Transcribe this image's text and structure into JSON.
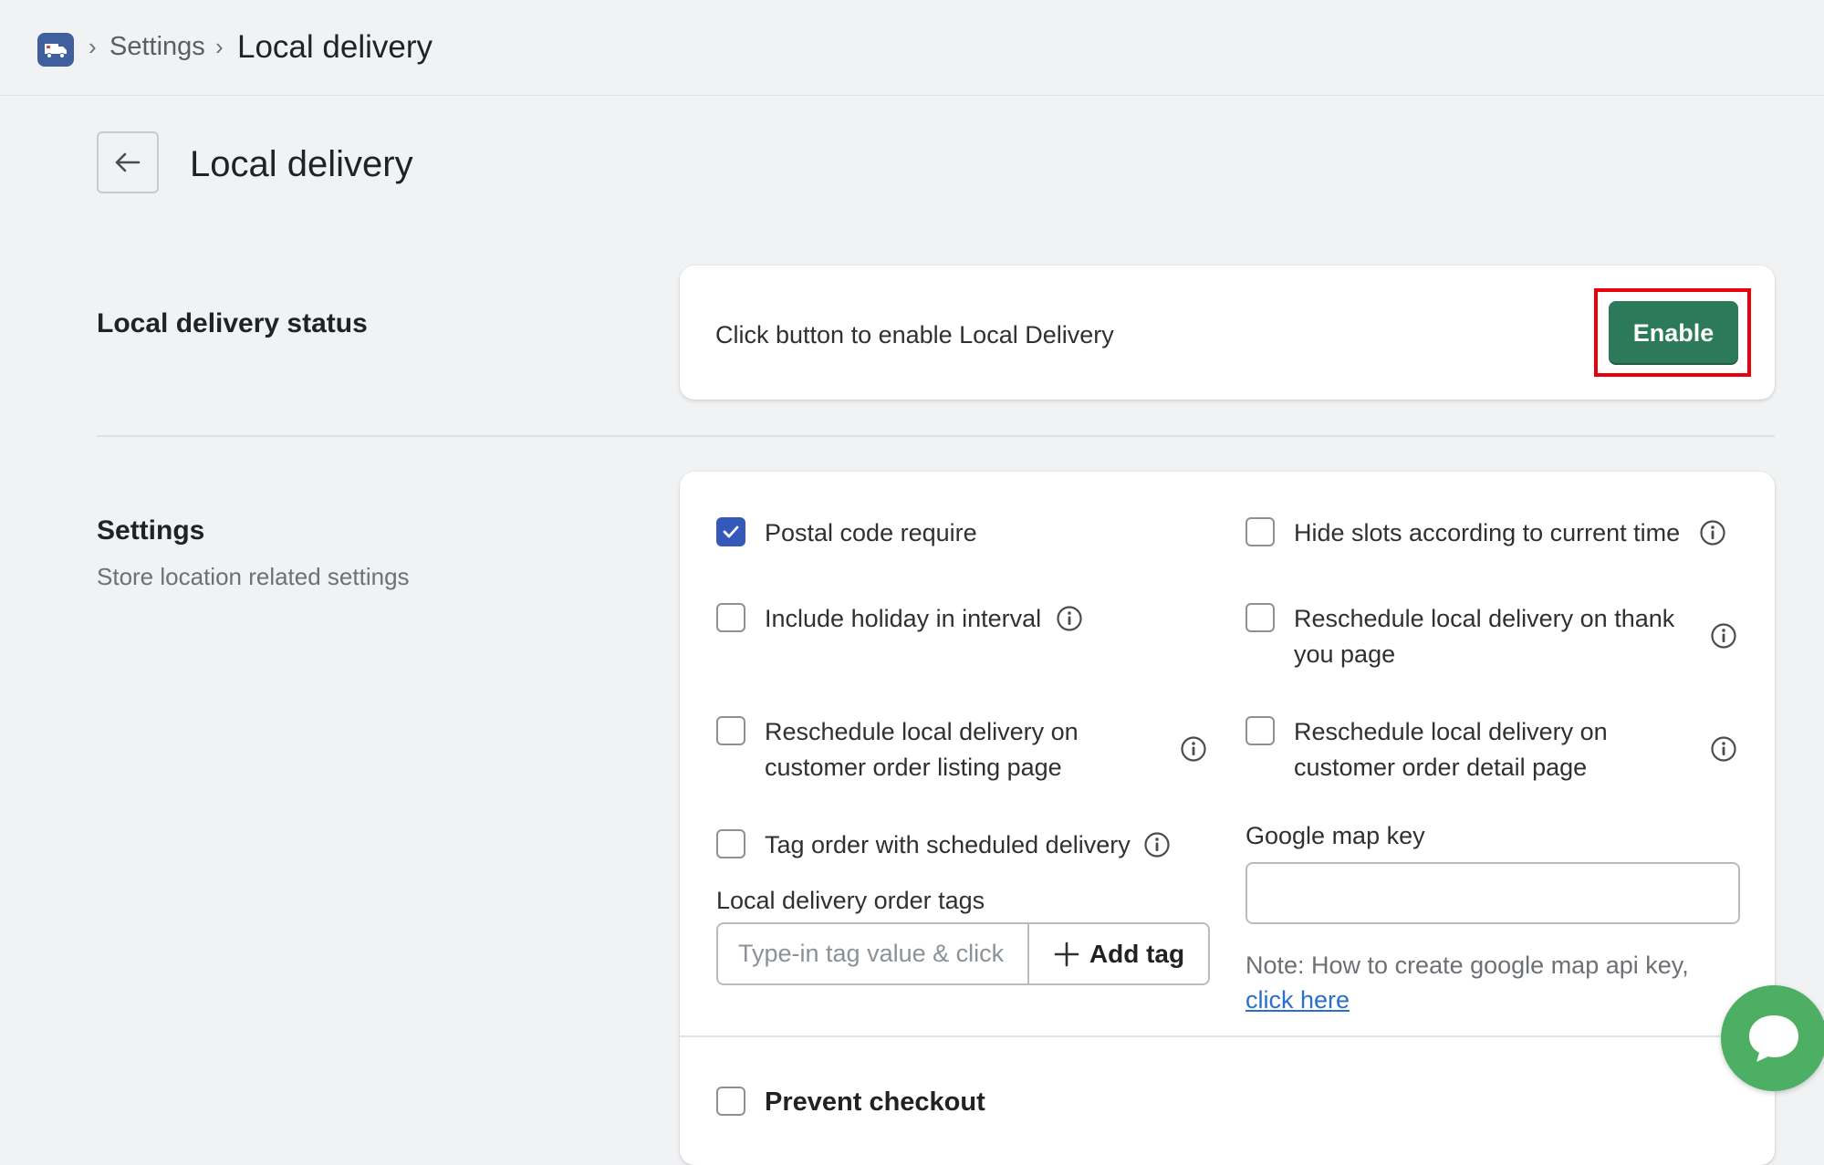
{
  "breadcrumb": {
    "app_icon": "delivery-truck-icon",
    "settings": "Settings",
    "current": "Local delivery"
  },
  "page": {
    "title": "Local delivery",
    "back_icon": "arrow-left-icon"
  },
  "status_section": {
    "title": "Local delivery status",
    "message": "Click button to enable Local Delivery",
    "enable_label": "Enable"
  },
  "settings_section": {
    "title": "Settings",
    "subtitle": "Store location related settings",
    "options": {
      "postal_code": {
        "label": "Postal code require",
        "checked": true
      },
      "hide_slots": {
        "label": "Hide slots according to current time",
        "checked": false
      },
      "holiday": {
        "label": "Include holiday in interval",
        "checked": false
      },
      "thank_you": {
        "label": "Reschedule local delivery on thank you page",
        "checked": false
      },
      "order_listing": {
        "label": "Reschedule local delivery on customer order listing page",
        "checked": false
      },
      "order_detail": {
        "label": "Reschedule local delivery on customer order detail page",
        "checked": false
      },
      "tag_order": {
        "label": "Tag order with scheduled delivery",
        "checked": false
      }
    },
    "tags": {
      "label": "Local delivery order tags",
      "placeholder": "Type-in tag value & click",
      "add_label": "Add tag"
    },
    "map_key": {
      "label": "Google map key",
      "value": "",
      "note": "Note: How to create google map api key,",
      "link": "click here"
    },
    "prevent_checkout": {
      "label": "Prevent checkout",
      "checked": false
    }
  },
  "colors": {
    "primary": "#2d7a5a",
    "checkbox_checked": "#3459b8",
    "highlight": "#e8000b",
    "chat": "#4caf64",
    "link": "#2c6ecb"
  }
}
